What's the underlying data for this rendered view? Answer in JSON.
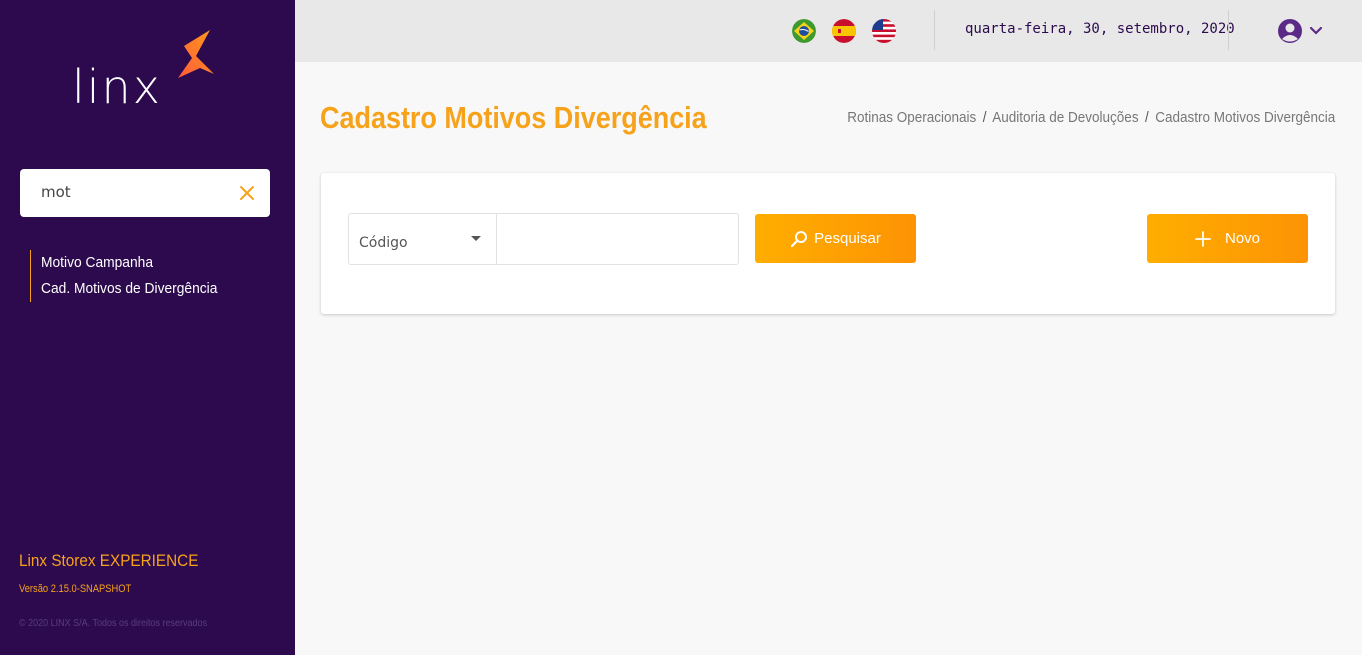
{
  "sidebar": {
    "logo_text": "linx",
    "search": {
      "value": "mot",
      "placeholder": ""
    },
    "menu": [
      {
        "label": "Motivo Campanha"
      },
      {
        "label": "Cad. Motivos de Divergência"
      }
    ],
    "brand": "Linx Storex EXPERIENCE",
    "version": "Versão 2.15.0-SNAPSHOT",
    "copyright": "© 2020 LINX S/A. Todos os direitos reservados"
  },
  "topbar": {
    "flags": [
      "brazil-flag-icon",
      "spain-flag-icon",
      "usa-flag-icon"
    ],
    "date": "quarta-feira, 30, setembro, 2020"
  },
  "page": {
    "title": "Cadastro Motivos Divergência",
    "breadcrumb": [
      "Rotinas Operacionais",
      "Auditoria de Devoluções",
      "Cadastro Motivos Divergência"
    ],
    "breadcrumb_separator": "/"
  },
  "filter": {
    "select_value": "Código",
    "search_value": "",
    "search_button": "Pesquisar",
    "new_button": "Novo"
  },
  "colors": {
    "sidebar_bg": "#2d0a4e",
    "accent": "#f7a21b",
    "button": "#fd9d04"
  }
}
